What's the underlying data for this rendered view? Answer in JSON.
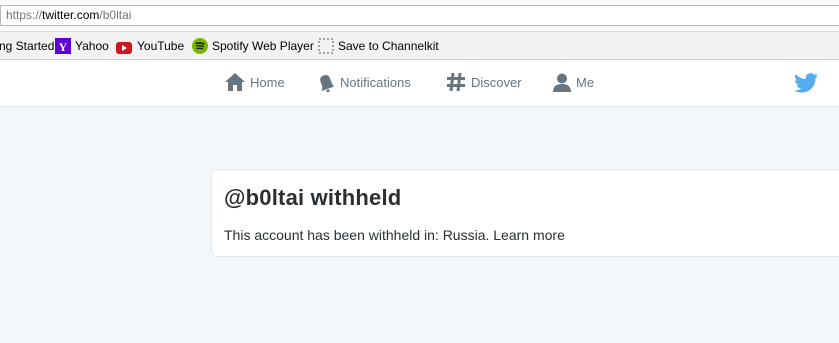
{
  "browser": {
    "url_prefix": "https://",
    "url_domain": "twitter.com",
    "url_path": "/b0ltai"
  },
  "bookmarks": [
    {
      "label": "ng Started",
      "icon": "none"
    },
    {
      "label": "Yahoo",
      "icon": "yahoo-icon",
      "color": "#5f01d1"
    },
    {
      "label": "YouTube",
      "icon": "youtube-icon",
      "color": "#cc181e"
    },
    {
      "label": "Spotify Web Player",
      "icon": "spotify-icon",
      "color": "#7ab800"
    },
    {
      "label": "Save to Channelkit",
      "icon": "dotted-square-icon"
    }
  ],
  "nav": {
    "home": "Home",
    "notifications": "Notifications",
    "discover": "Discover",
    "me": "Me"
  },
  "colors": {
    "twitter_blue": "#55acee",
    "nav_gray": "#66757f",
    "text_dark": "#292f33"
  },
  "card": {
    "title": "@b0ltai withheld",
    "message": "This account has been withheld in: Russia.",
    "link": "Learn more"
  }
}
